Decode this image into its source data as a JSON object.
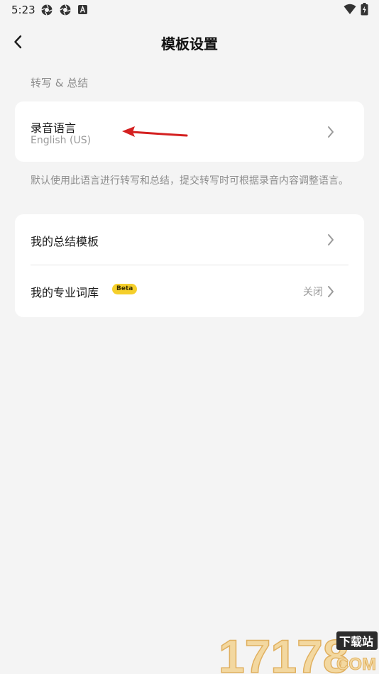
{
  "status_bar": {
    "time": "5:23",
    "icons": [
      "aperture-icon",
      "aperture-icon",
      "a-box-icon",
      "wifi-icon",
      "battery-icon"
    ]
  },
  "header": {
    "back_icon": "chevron-left-icon",
    "title": "模板设置"
  },
  "section": {
    "label": "转写 & 总结"
  },
  "language_card": {
    "title": "录音语言",
    "value": "English (US)"
  },
  "note": "默认使用此语言进行转写和总结，提交转写时可根据录音内容调整语言。",
  "list": {
    "items": [
      {
        "label": "我的总结模板",
        "value": "",
        "badge": ""
      },
      {
        "label": "我的专业词库",
        "value": "关闭",
        "badge": "Beta"
      }
    ]
  },
  "watermark": {
    "number": "17178",
    "tag": "下载站",
    "domain": "COM"
  },
  "colors": {
    "background": "#f4f4f4",
    "card": "#ffffff",
    "secondary_text": "#8d8d8d",
    "badge": "#f5cf2b",
    "annotation_arrow": "#d42020"
  }
}
